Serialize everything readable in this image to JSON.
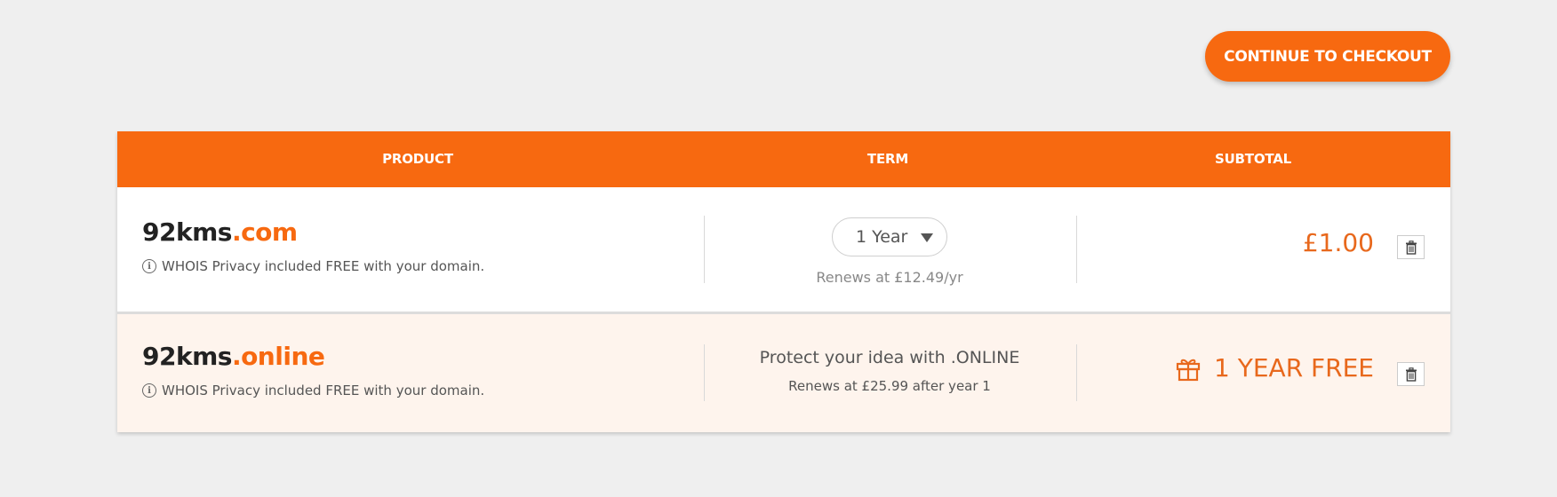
{
  "header": {
    "checkout_label": "CONTINUE TO CHECKOUT"
  },
  "table": {
    "columns": [
      "PRODUCT",
      "TERM",
      "SUBTOTAL"
    ]
  },
  "items": [
    {
      "domain_name": "92kms",
      "domain_tld": ".com",
      "whois_note": "WHOIS Privacy included FREE with your domain.",
      "term_value": "1 Year",
      "renewal_text": "Renews at £12.49/yr",
      "subtotal": "£1.00"
    },
    {
      "domain_name": "92kms",
      "domain_tld": ".online",
      "whois_note": "WHOIS Privacy included FREE with your domain.",
      "promo_text": "Protect your idea with .ONLINE",
      "renewal_text": "Renews at £25.99 after year 1",
      "subtotal": "1 YEAR FREE"
    }
  ],
  "icons": {
    "info": "info-icon",
    "delete": "trash-icon",
    "gift": "gift-icon",
    "dropdown": "caret-down-icon"
  },
  "colors": {
    "accent": "#f76910",
    "price": "#e8681c",
    "background": "#efefef",
    "highlight_row": "#fef4ed"
  }
}
